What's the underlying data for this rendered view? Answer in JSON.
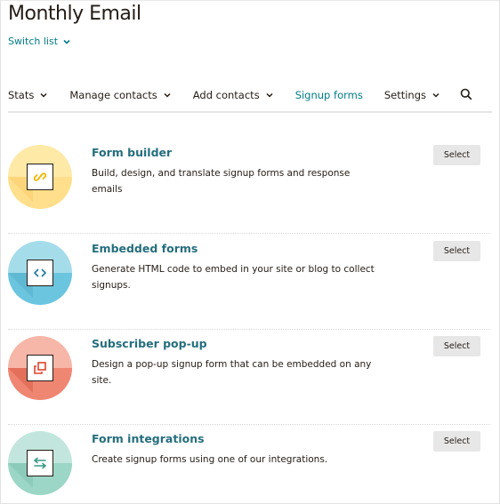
{
  "header": {
    "title": "Monthly Email",
    "switch_list_label": "Switch list"
  },
  "nav": {
    "items": [
      {
        "label": "Stats",
        "has_dropdown": true,
        "active": false
      },
      {
        "label": "Manage contacts",
        "has_dropdown": true,
        "active": false
      },
      {
        "label": "Add contacts",
        "has_dropdown": true,
        "active": false
      },
      {
        "label": "Signup forms",
        "has_dropdown": false,
        "active": true
      },
      {
        "label": "Settings",
        "has_dropdown": true,
        "active": false
      }
    ],
    "search_icon": "search-icon"
  },
  "colors": {
    "link": "#007c89",
    "title_link": "#256e7e",
    "text": "#241c15",
    "button_bg": "#e7e7e7"
  },
  "forms": [
    {
      "title": "Form builder",
      "description": "Build, design, and translate signup forms and response emails",
      "button_label": "Select",
      "icon": "link-icon",
      "color_top": "#ffe9a6",
      "color_bottom": "#ffdf8c",
      "glyph_color": "#f2b600"
    },
    {
      "title": "Embedded forms",
      "description": "Generate HTML code to embed in your site or blog to collect signups.",
      "button_label": "Select",
      "icon": "code-icon",
      "color_top": "#a5dcea",
      "color_bottom": "#6cc5de",
      "glyph_color": "#2a7ea1"
    },
    {
      "title": "Subscriber pop-up",
      "description": "Design a pop-up signup form that can be embedded on any site.",
      "button_label": "Select",
      "icon": "popup-icon",
      "color_top": "#f6b6a8",
      "color_bottom": "#ef8672",
      "glyph_color": "#e0452b"
    },
    {
      "title": "Form integrations",
      "description": "Create signup forms using one of our integrations.",
      "button_label": "Select",
      "icon": "arrows-exchange-icon",
      "color_top": "#c2e6dd",
      "color_bottom": "#9bd6c6",
      "glyph_color": "#3a9b85"
    }
  ]
}
